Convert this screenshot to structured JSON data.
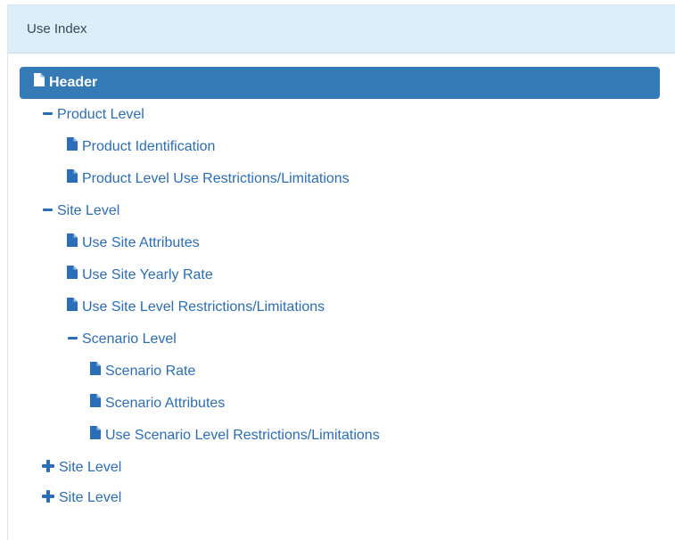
{
  "panel": {
    "title": "Use Index"
  },
  "tree": {
    "header": {
      "label": "Header",
      "icon": "file-icon"
    },
    "product_level": {
      "label": "Product Level",
      "icon": "minus-icon"
    },
    "product_identification": {
      "label": "Product Identification",
      "icon": "file-icon"
    },
    "product_level_restrictions": {
      "label": "Product Level Use Restrictions/Limitations",
      "icon": "file-icon"
    },
    "site_level_1": {
      "label": "Site Level",
      "icon": "minus-icon"
    },
    "use_site_attributes": {
      "label": "Use Site Attributes",
      "icon": "file-icon"
    },
    "use_site_yearly_rate": {
      "label": "Use Site Yearly Rate",
      "icon": "file-icon"
    },
    "use_site_level_restrictions": {
      "label": "Use Site Level Restrictions/Limitations",
      "icon": "file-icon"
    },
    "scenario_level": {
      "label": "Scenario Level",
      "icon": "minus-icon"
    },
    "scenario_rate": {
      "label": "Scenario Rate",
      "icon": "file-icon"
    },
    "scenario_attributes": {
      "label": "Scenario Attributes",
      "icon": "file-icon"
    },
    "use_scenario_level_restrictions": {
      "label": "Use Scenario Level Restrictions/Limitations",
      "icon": "file-icon"
    },
    "site_level_2": {
      "label": "Site Level",
      "icon": "plus-icon"
    },
    "site_level_3": {
      "label": "Site Level",
      "icon": "plus-icon"
    }
  },
  "colors": {
    "link": "#2a6db8",
    "active_bg": "#337ab7",
    "heading_bg": "#dceef8"
  }
}
